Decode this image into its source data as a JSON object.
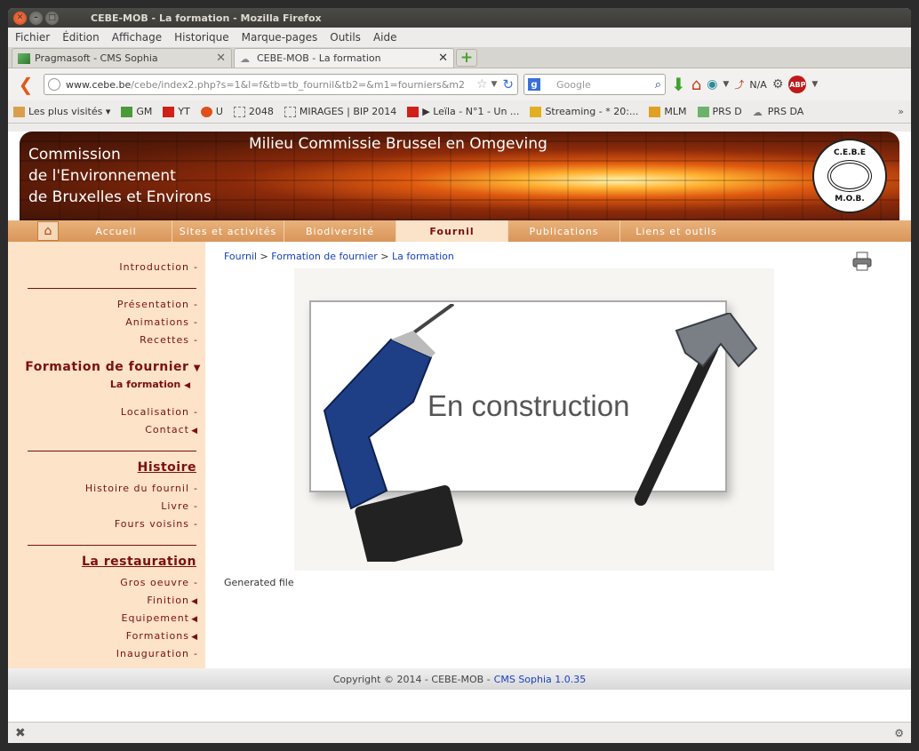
{
  "window": {
    "title": "CEBE-MOB - La formation - Mozilla Firefox"
  },
  "menu": [
    "Fichier",
    "Édition",
    "Affichage",
    "Historique",
    "Marque-pages",
    "Outils",
    "Aide"
  ],
  "tabs": [
    {
      "label": "Pragmasoft - CMS Sophia",
      "active": false
    },
    {
      "label": "CEBE-MOB - La formation",
      "active": true
    }
  ],
  "address": {
    "domain": "www.cebe.be",
    "path": "/cebe/index2.php?s=1&l=f&tb=tb_fournil&tb2=&m1=fourniers&m2"
  },
  "search": {
    "placeholder": "Google"
  },
  "toolbar": {
    "na_label": "N/A",
    "abp_label": "ABP"
  },
  "bookmarks": [
    "Les plus visités",
    "GM",
    "YT",
    "U",
    "2048",
    "MIRAGES | BIP 2014",
    "▶ Leïla - N°1 - Un ...",
    "Streaming - * 20:...",
    "MLM",
    "PRS D",
    "PRS DA"
  ],
  "site": {
    "banner_left": [
      "Commission",
      "de l'Environnement",
      "de Bruxelles et Environs"
    ],
    "banner_center": "Milieu Commissie Brussel en Omgeving",
    "logo_top": "C.E.B.E",
    "logo_bottom": "M.O.B.",
    "nav": [
      "Accueil",
      "Sites et activités",
      "Biodiversité",
      "Fournil",
      "Publications",
      "Liens et outils"
    ],
    "nav_active": "Fournil"
  },
  "sidebar": {
    "introduction": "Introduction",
    "presentation": "Présentation",
    "animations": "Animations",
    "recettes": "Recettes",
    "formation_group": "Formation de fournier",
    "la_formation": "La formation",
    "localisation": "Localisation",
    "contact": "Contact",
    "histoire_head": "Histoire",
    "histoire_fournil": "Histoire du fournil",
    "livre": "Livre",
    "fours_voisins": "Fours voisins",
    "restauration_head": "La restauration",
    "gros_oeuvre": "Gros oeuvre",
    "finition": "Finition",
    "equipement": "Equipement",
    "formations": "Formations",
    "inauguration": "Inauguration"
  },
  "breadcrumb": {
    "a": "Fournil",
    "sep1": " > ",
    "b": "Formation de fournier",
    "sep2": " > ",
    "c": "La formation"
  },
  "content": {
    "construction_text": "En construction",
    "generated": "Generated file"
  },
  "footer": {
    "copyright": "Copyright © 2014 - CEBE-MOB -",
    "cms": "CMS Sophia 1.0.35"
  }
}
